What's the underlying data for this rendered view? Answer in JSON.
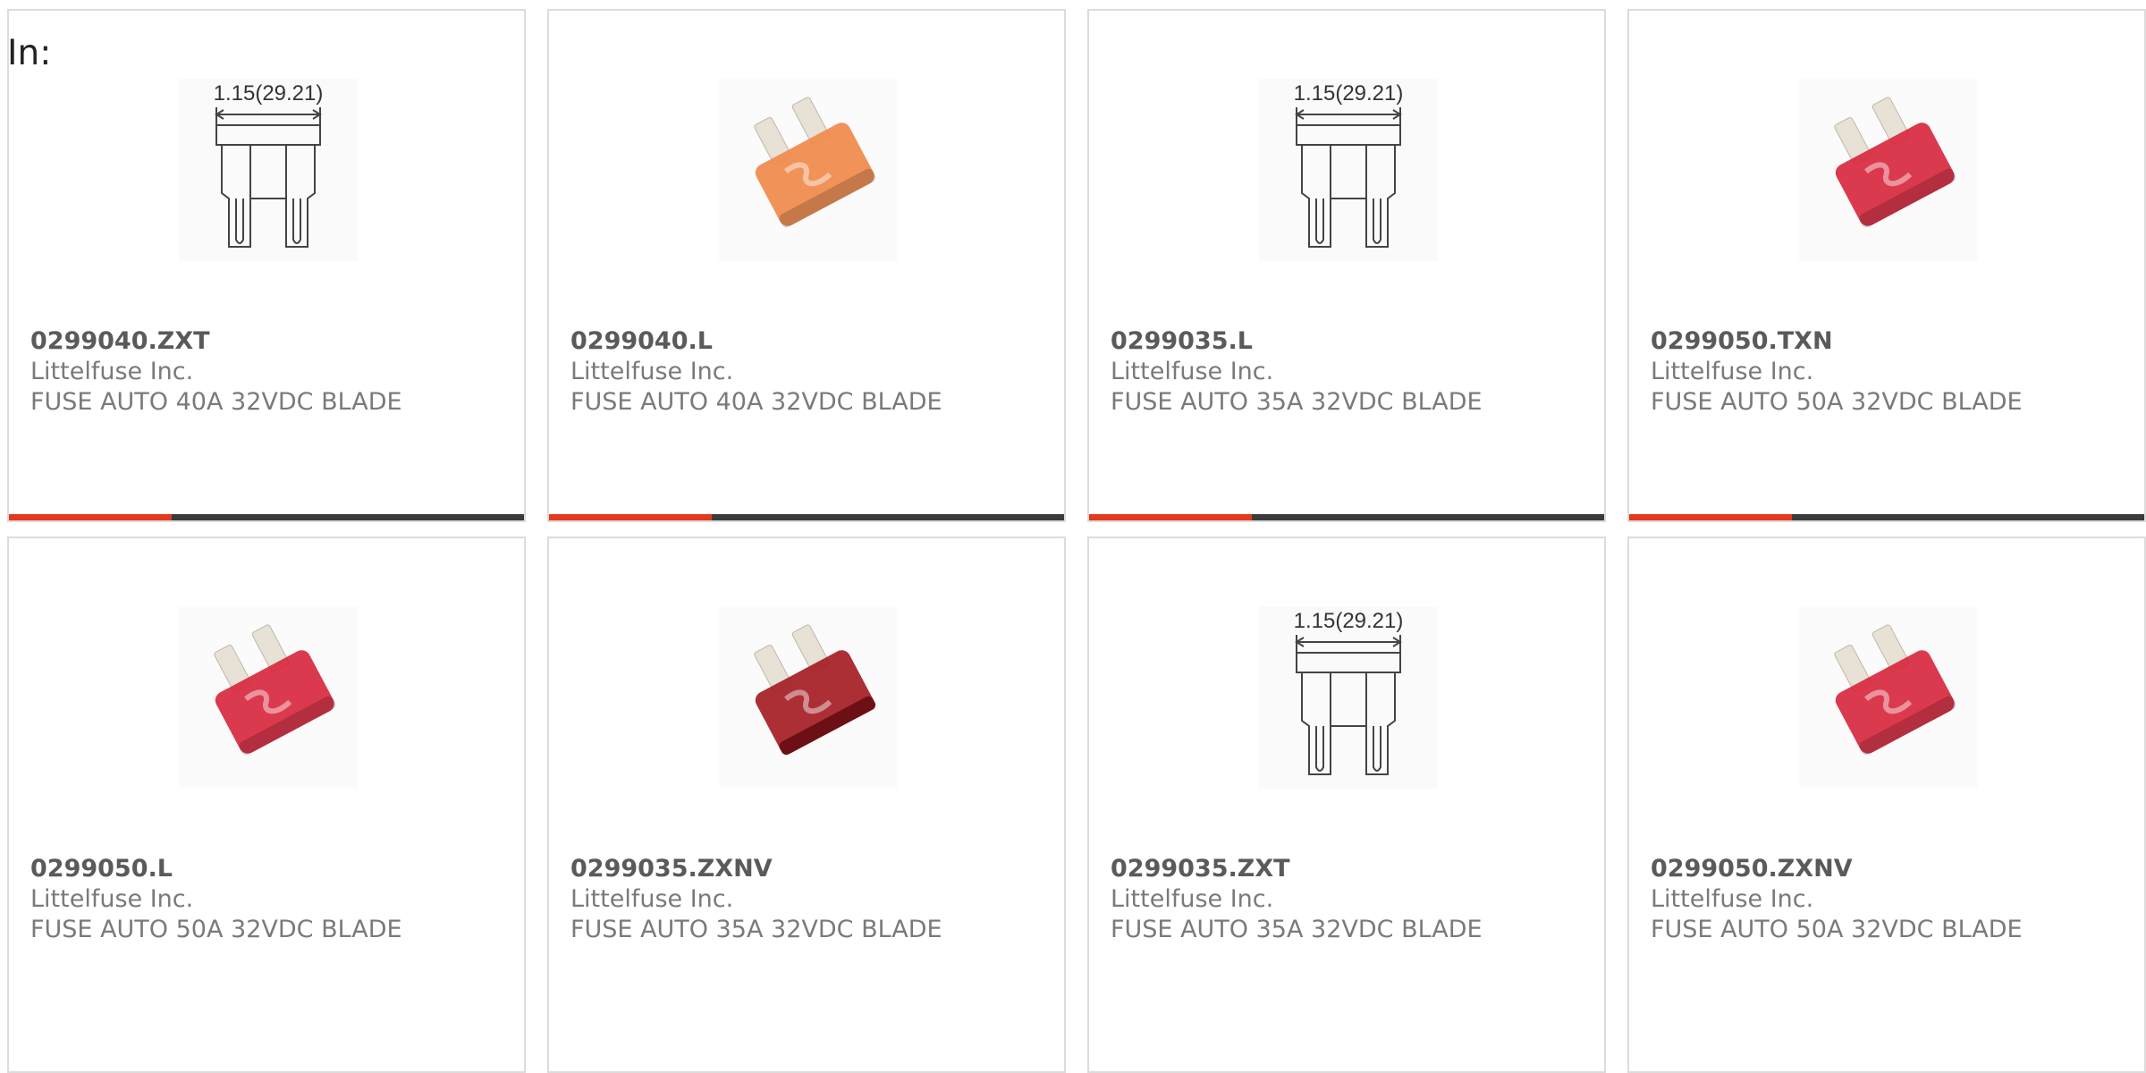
{
  "filter_label": "In:",
  "accent_color": "#e3391c",
  "bar_color": "#3b3b3b",
  "products": [
    {
      "part_number": "0299040.ZXT",
      "manufacturer": "Littelfuse Inc.",
      "description": "FUSE AUTO 40A 32VDC BLADE",
      "image": "drawing",
      "dimension_label": "1.15(29.21)"
    },
    {
      "part_number": "0299040.L",
      "manufacturer": "Littelfuse Inc.",
      "description": "FUSE AUTO 40A 32VDC BLADE",
      "image": "fuse-photo",
      "fuse_color": "#f08a4b"
    },
    {
      "part_number": "0299035.L",
      "manufacturer": "Littelfuse Inc.",
      "description": "FUSE AUTO 35A 32VDC BLADE",
      "image": "drawing",
      "dimension_label": "1.15(29.21)"
    },
    {
      "part_number": "0299050.TXN",
      "manufacturer": "Littelfuse Inc.",
      "description": "FUSE AUTO 50A 32VDC BLADE",
      "image": "fuse-photo",
      "fuse_color": "#d8283e"
    },
    {
      "part_number": "0299050.L",
      "manufacturer": "Littelfuse Inc.",
      "description": "FUSE AUTO 50A 32VDC BLADE",
      "image": "fuse-photo",
      "fuse_color": "#d8283e"
    },
    {
      "part_number": "0299035.ZXNV",
      "manufacturer": "Littelfuse Inc.",
      "description": "FUSE AUTO 35A 32VDC BLADE",
      "image": "fuse-photo-nv",
      "fuse_color": "#a51d24"
    },
    {
      "part_number": "0299035.ZXT",
      "manufacturer": "Littelfuse Inc.",
      "description": "FUSE AUTO 35A 32VDC BLADE",
      "image": "drawing",
      "dimension_label": "1.15(29.21)"
    },
    {
      "part_number": "0299050.ZXNV",
      "manufacturer": "Littelfuse Inc.",
      "description": "FUSE AUTO 50A 32VDC BLADE",
      "image": "fuse-photo",
      "fuse_color": "#d8283e"
    }
  ]
}
